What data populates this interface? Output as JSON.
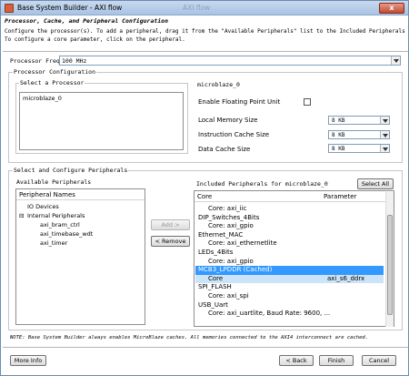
{
  "window": {
    "title": "Base System Builder - AXI flow",
    "background_title": "AXI flow",
    "close_label": "x"
  },
  "header": {
    "title": "Processor, Cache, and Peripheral Configuration",
    "desc1": "Configure the processor(s). To add a peripheral, drag it from the \"Available Peripherals\" list to the Included Peripherals list.",
    "desc2": "To configure a core parameter, click on the peripheral."
  },
  "processor_frequency": {
    "label": "Processor Frequency",
    "value": "100 MHz"
  },
  "processor_config": {
    "group_label": "Processor Configuration",
    "select_label": "Select a Processor",
    "processors": [
      "microblaze_0"
    ],
    "selected_processor_heading": "microblaze_0",
    "floating_point_label": "Enable Floating Point Unit",
    "floating_point_checked": false,
    "local_memory_label": "Local Memory Size",
    "local_memory_value": "8 KB",
    "icache_label": "Instruction Cache Size",
    "icache_value": "8 KB",
    "dcache_label": "Data Cache Size",
    "dcache_value": "8 KB"
  },
  "peripherals": {
    "group_label": "Select and Configure Peripherals",
    "available_label": "Available Peripherals",
    "available_header": "Peripheral Names",
    "available_items": [
      "IO Devices",
      "Internal Peripherals",
      "axi_bram_ctrl",
      "axi_timebase_wdt",
      "axi_timer"
    ],
    "add_label": "Add >",
    "remove_label": "< Remove",
    "included_label": "Included Peripherals for microblaze_0",
    "select_all_label": "Select All",
    "col_core": "Core",
    "col_parameter": "Parameter",
    "included_rows": [
      {
        "core": "Core: axi_iic",
        "param": ""
      },
      {
        "core": "DIP_Switches_4Bits",
        "param": ""
      },
      {
        "core": "Core: axi_gpio",
        "param": ""
      },
      {
        "core": "Ethernet_MAC",
        "param": ""
      },
      {
        "core": "Core: axi_ethernetlite",
        "param": ""
      },
      {
        "core": "LEDs_4Bits",
        "param": ""
      },
      {
        "core": "Core: axi_gpio",
        "param": ""
      },
      {
        "core": "MCB3_LPDDR (Cached)",
        "param": ""
      },
      {
        "core": "Core",
        "param": "axi_s6_ddrx"
      },
      {
        "core": "SPI_FLASH",
        "param": ""
      },
      {
        "core": "Core: axi_spi",
        "param": ""
      },
      {
        "core": "USB_Uart",
        "param": ""
      },
      {
        "core": "Core: axi_uartlite, Baud Rate: 9600, ...",
        "param": ""
      }
    ]
  },
  "note": "NOTE: Base System Builder always enables MicroBlaze caches.  All memories connected to the AXI4 interconnect are cached.",
  "footer": {
    "more_info": "More Info",
    "back": "< Back",
    "finish": "Finish",
    "cancel": "Cancel"
  }
}
